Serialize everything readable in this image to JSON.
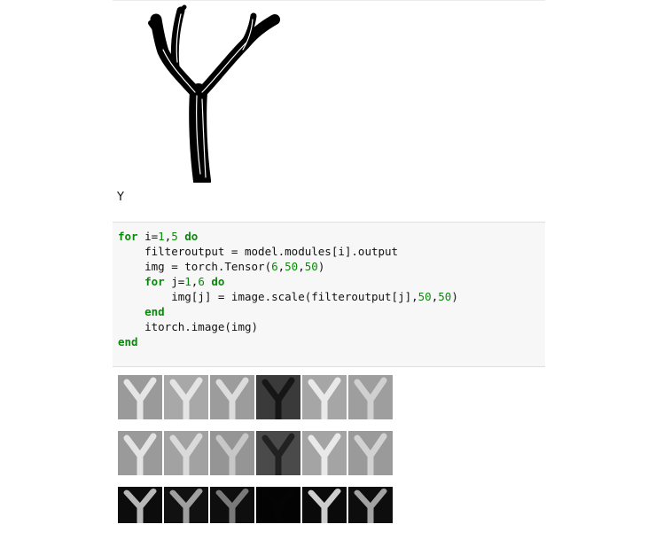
{
  "output": {
    "label": "Y"
  },
  "code_cell": {
    "lines": [
      [
        {
          "t": "for",
          "c": "kw"
        },
        {
          "t": " i="
        },
        {
          "t": "1",
          "c": "num"
        },
        {
          "t": ","
        },
        {
          "t": "5",
          "c": "num"
        },
        {
          "t": " "
        },
        {
          "t": "do",
          "c": "kw"
        }
      ],
      [
        {
          "t": "    filteroutput = model.modules[i].output"
        }
      ],
      [
        {
          "t": "    img = torch.Tensor("
        },
        {
          "t": "6",
          "c": "num"
        },
        {
          "t": ","
        },
        {
          "t": "50",
          "c": "num"
        },
        {
          "t": ","
        },
        {
          "t": "50",
          "c": "num"
        },
        {
          "t": ")"
        }
      ],
      [
        {
          "t": "    "
        },
        {
          "t": "for",
          "c": "kw"
        },
        {
          "t": " j="
        },
        {
          "t": "1",
          "c": "num"
        },
        {
          "t": ","
        },
        {
          "t": "6",
          "c": "num"
        },
        {
          "t": " "
        },
        {
          "t": "do",
          "c": "kw"
        }
      ],
      [
        {
          "t": "        img[j] = image.scale(filteroutput[j],"
        },
        {
          "t": "50",
          "c": "num"
        },
        {
          "t": ","
        },
        {
          "t": "50",
          "c": "num"
        },
        {
          "t": ")"
        }
      ],
      [
        {
          "t": "    "
        },
        {
          "t": "end",
          "c": "kw"
        }
      ],
      [
        {
          "t": "    itorch.image(img)"
        }
      ],
      [
        {
          "t": "end",
          "c": "kw"
        }
      ]
    ]
  },
  "feature_maps": {
    "rows": [
      [
        {
          "bg": "#9a9a9a",
          "fg": "#f2f2f2"
        },
        {
          "bg": "#a8a8a8",
          "fg": "#efefef"
        },
        {
          "bg": "#9c9c9c",
          "fg": "#e8e8e8"
        },
        {
          "bg": "#3a3a3a",
          "fg": "#101010"
        },
        {
          "bg": "#a6a6a6",
          "fg": "#f4f4f4"
        },
        {
          "bg": "#9e9e9e",
          "fg": "#d8d8d8"
        }
      ],
      [
        {
          "bg": "#9a9a9a",
          "fg": "#f0f0f0"
        },
        {
          "bg": "#a2a2a2",
          "fg": "#e4e4e4"
        },
        {
          "bg": "#959595",
          "fg": "#d0d0d0"
        },
        {
          "bg": "#4a4a4a",
          "fg": "#1a1a1a"
        },
        {
          "bg": "#a4a4a4",
          "fg": "#f6f6f6"
        },
        {
          "bg": "#9a9a9a",
          "fg": "#dcdcdc"
        }
      ],
      [
        {
          "bg": "#0c0c0c",
          "fg": "#d6d6d6"
        },
        {
          "bg": "#111111",
          "fg": "#b8b8b8"
        },
        {
          "bg": "#0e0e0e",
          "fg": "#8c8c8c"
        },
        {
          "bg": "#030303",
          "fg": "#050505"
        },
        {
          "bg": "#0a0a0a",
          "fg": "#f0f0f0"
        },
        {
          "bg": "#0d0d0d",
          "fg": "#bdbdbd"
        }
      ]
    ]
  }
}
